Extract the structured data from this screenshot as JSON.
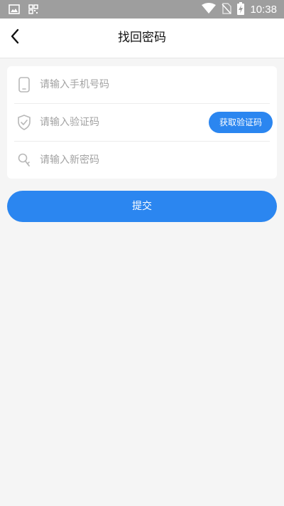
{
  "status_bar": {
    "time": "10:38",
    "icons": [
      "image-icon",
      "qr-icon",
      "wifi-icon",
      "no-sim-icon",
      "battery-charging-icon"
    ]
  },
  "header": {
    "title": "找回密码",
    "back_icon": "chevron-left-icon"
  },
  "form": {
    "phone": {
      "placeholder": "请输入手机号码",
      "icon": "phone-icon"
    },
    "code": {
      "placeholder": "请输入验证码",
      "icon": "shield-check-icon",
      "button_label": "获取验证码"
    },
    "password": {
      "placeholder": "请输入新密码",
      "icon": "key-icon"
    }
  },
  "submit_label": "提交",
  "colors": {
    "accent": "#2b86f0",
    "status_bar": "#9e9e9e",
    "background": "#f5f5f5",
    "placeholder": "#a3a3a3"
  }
}
